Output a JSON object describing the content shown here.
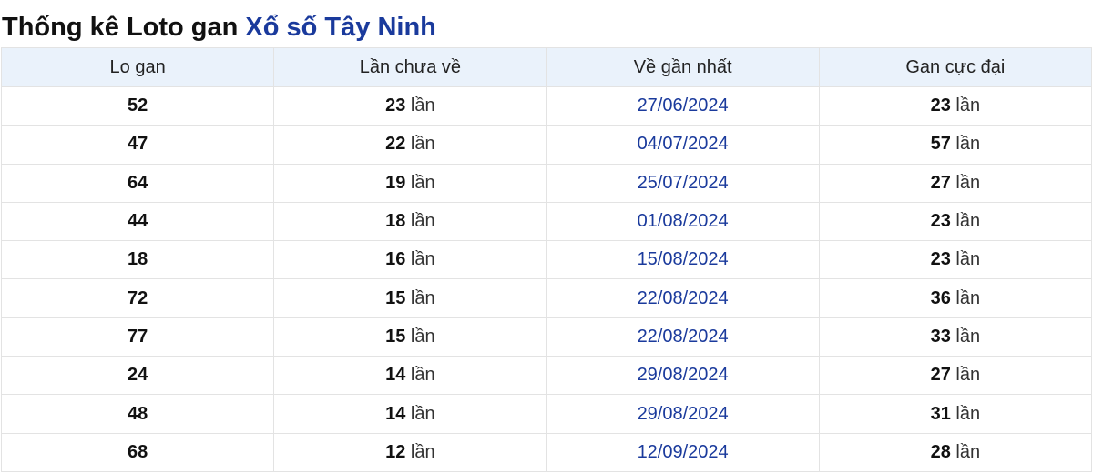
{
  "page": {
    "title_prefix": "Thống kê Loto gan",
    "title_province": "Xổ số Tây Ninh"
  },
  "table": {
    "headers": [
      "Lo gan",
      "Lần chưa về",
      "Về gần nhất",
      "Gan cực đại"
    ],
    "unit": "lần",
    "rows": [
      {
        "lo": "52",
        "chua_ve": "23",
        "gan_nhat": "27/06/2024",
        "cuc_dai": "23"
      },
      {
        "lo": "47",
        "chua_ve": "22",
        "gan_nhat": "04/07/2024",
        "cuc_dai": "57"
      },
      {
        "lo": "64",
        "chua_ve": "19",
        "gan_nhat": "25/07/2024",
        "cuc_dai": "27"
      },
      {
        "lo": "44",
        "chua_ve": "18",
        "gan_nhat": "01/08/2024",
        "cuc_dai": "23"
      },
      {
        "lo": "18",
        "chua_ve": "16",
        "gan_nhat": "15/08/2024",
        "cuc_dai": "23"
      },
      {
        "lo": "72",
        "chua_ve": "15",
        "gan_nhat": "22/08/2024",
        "cuc_dai": "36"
      },
      {
        "lo": "77",
        "chua_ve": "15",
        "gan_nhat": "22/08/2024",
        "cuc_dai": "33"
      },
      {
        "lo": "24",
        "chua_ve": "14",
        "gan_nhat": "29/08/2024",
        "cuc_dai": "27"
      },
      {
        "lo": "48",
        "chua_ve": "14",
        "gan_nhat": "29/08/2024",
        "cuc_dai": "31"
      },
      {
        "lo": "68",
        "chua_ve": "12",
        "gan_nhat": "12/09/2024",
        "cuc_dai": "28"
      }
    ]
  },
  "colors": {
    "accent": "#1a3a9c",
    "header_bg": "#eaf2fb",
    "border": "#e3e3e3"
  }
}
